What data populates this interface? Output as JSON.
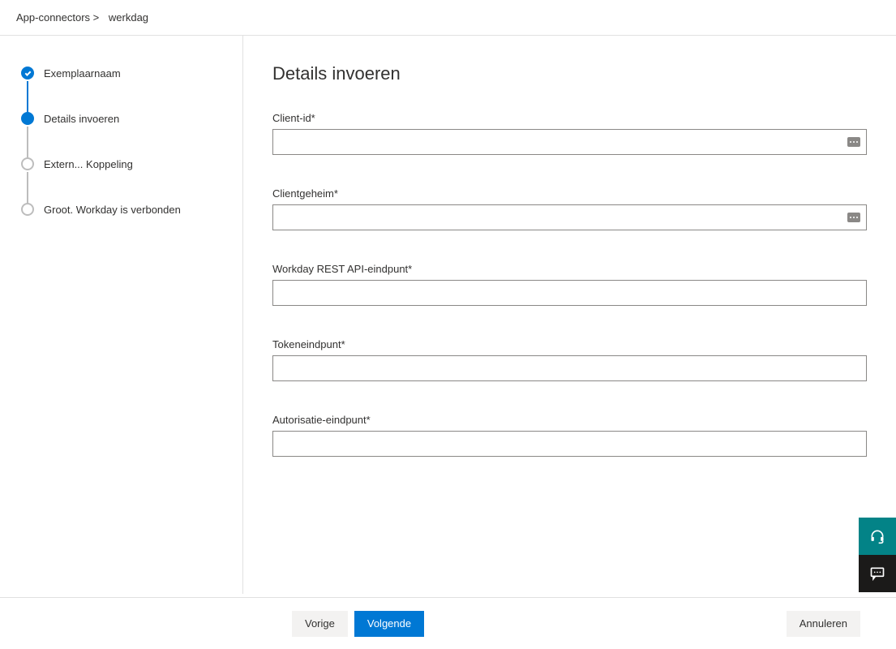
{
  "breadcrumb": {
    "part1": "App-connectors >",
    "part2": "werkdag"
  },
  "steps": {
    "s1": {
      "label": "Exemplaarnaam"
    },
    "s2": {
      "label": "Details invoeren"
    },
    "s3": {
      "label": "Extern... Koppeling"
    },
    "s4": {
      "label": "Groot. Workday is verbonden"
    }
  },
  "main": {
    "title": "Details invoeren",
    "fields": {
      "client_id": {
        "label": "Client-id*",
        "value": ""
      },
      "client_secret": {
        "label": "Clientgeheim*",
        "value": ""
      },
      "rest_endpoint": {
        "label": "Workday REST API-eindpunt*",
        "value": ""
      },
      "token_endpoint": {
        "label": "Tokeneindpunt*",
        "value": ""
      },
      "auth_endpoint": {
        "label": "Autorisatie-eindpunt*",
        "value": ""
      }
    }
  },
  "footer": {
    "prev": "Vorige",
    "next": "Volgende",
    "cancel": "Annuleren"
  }
}
